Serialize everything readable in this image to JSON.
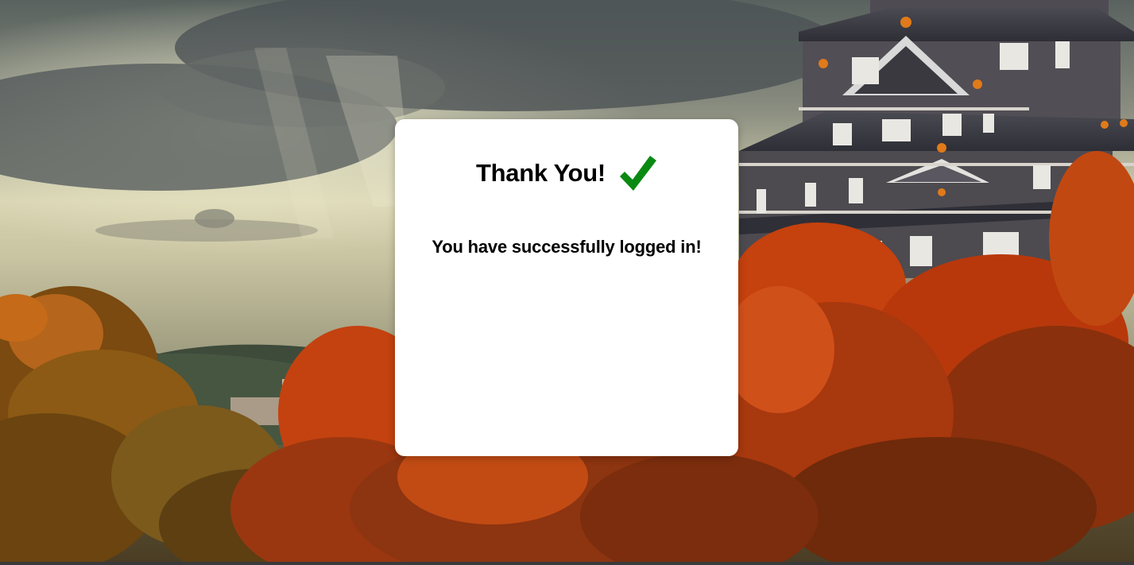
{
  "background": {
    "image": "castle-autumn-landscape"
  },
  "card": {
    "title": "Thank You!",
    "icon": "checkmark-icon",
    "message": "You have successfully logged in!"
  },
  "colors": {
    "card_background": "#ffffff",
    "check_green": "#0a8a12",
    "text": "#000000"
  }
}
